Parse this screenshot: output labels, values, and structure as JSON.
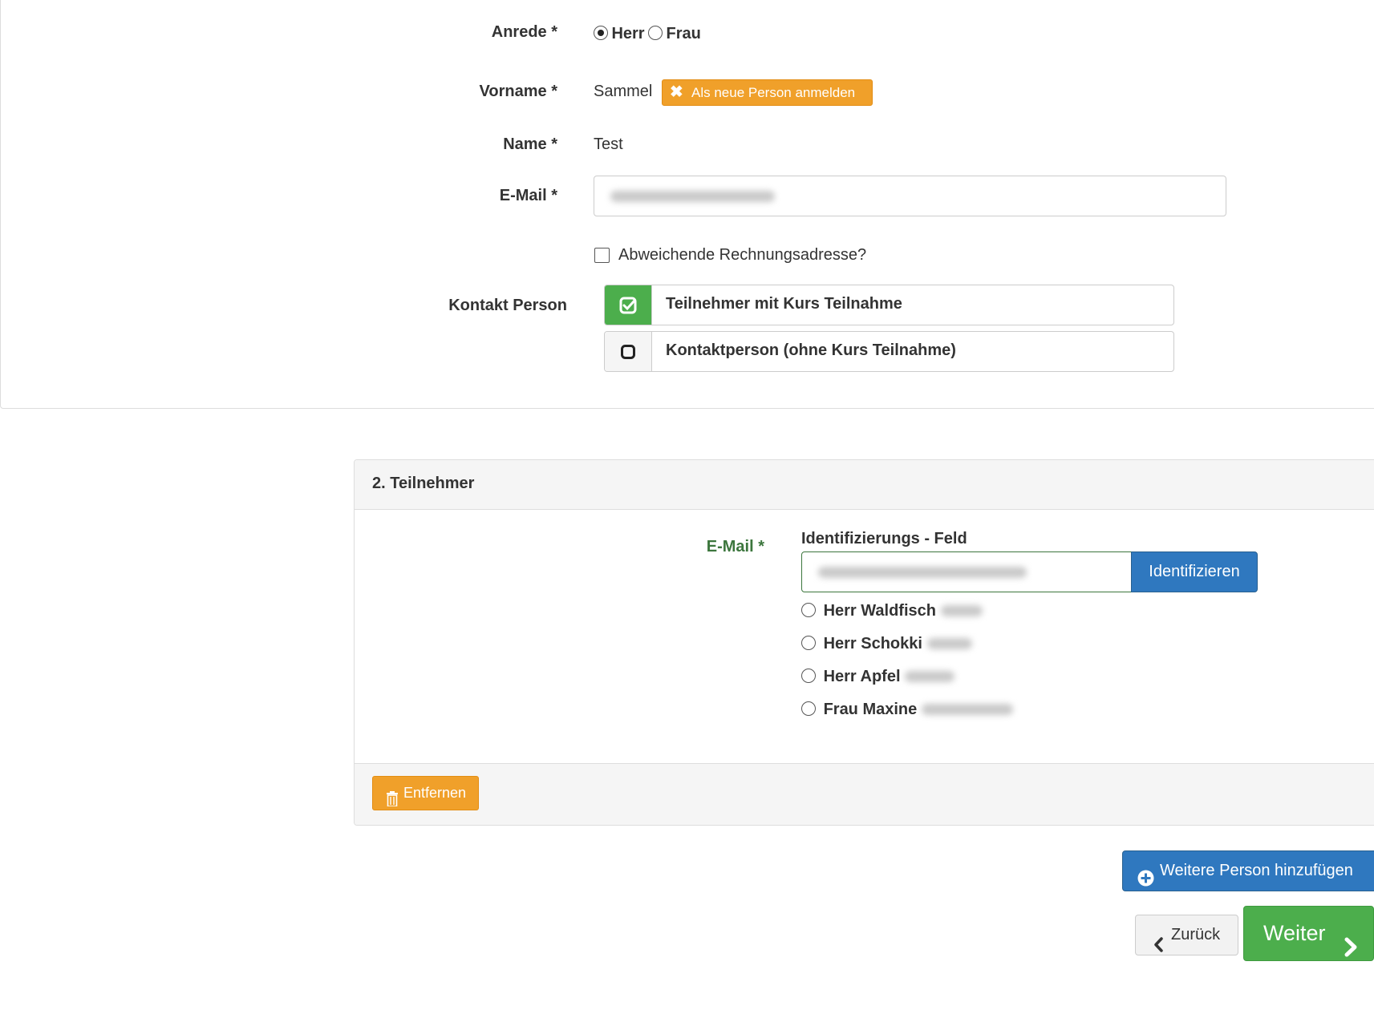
{
  "form": {
    "salutation_label": "Anrede *",
    "salutation_options": [
      "Herr",
      "Frau"
    ],
    "salutation_selected": "Herr",
    "firstname_label": "Vorname *",
    "firstname_value": "Sammel",
    "register_new_label": "Als neue Person anmelden",
    "name_label": "Name *",
    "name_value": "Test",
    "email_label": "E-Mail *",
    "billing_label": "Abweichende Rechnungsadresse?",
    "contact_label": "Kontakt Person",
    "contact_options": [
      {
        "label": "Teilnehmer mit Kurs Teilnahme",
        "selected": true
      },
      {
        "label": "Kontaktperson (ohne Kurs Teilnahme)",
        "selected": false
      }
    ]
  },
  "participant": {
    "title": "2. Teilnehmer",
    "email_label": "E-Mail *",
    "id_field_label": "Identifizierungs - Feld",
    "identify_button": "Identifizieren",
    "persons": [
      {
        "name": "Herr Waldfisch"
      },
      {
        "name": "Herr Schokki"
      },
      {
        "name": "Herr Apfel"
      },
      {
        "name": "Frau Maxine"
      }
    ],
    "remove_button": "Entfernen"
  },
  "actions": {
    "add_person": "Weitere Person hinzufügen",
    "back": "Zurück",
    "next": "Weiter"
  },
  "colors": {
    "orange": "#f0a02a",
    "blue": "#2f78bf",
    "green": "#4cae4c",
    "label_green": "#3c763d"
  }
}
